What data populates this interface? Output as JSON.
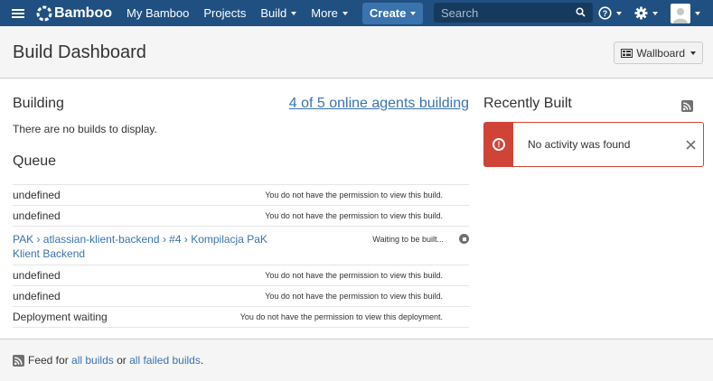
{
  "nav": {
    "brand": "Bamboo",
    "my_bamboo": "My Bamboo",
    "projects": "Projects",
    "build": "Build",
    "more": "More",
    "create": "Create",
    "search_placeholder": "Search"
  },
  "header": {
    "title": "Build Dashboard",
    "wallboard_label": "Wallboard"
  },
  "building": {
    "title": "Building",
    "agents_link": "4 of 5 online agents building",
    "empty_text": "There are no builds to display."
  },
  "queue": {
    "title": "Queue",
    "rows": [
      {
        "name": "undefined",
        "status": "You do not have the permission to view this build."
      },
      {
        "name": "undefined",
        "status": "You do not have the permission to view this build."
      },
      {
        "name": "PAK › atlassian-klient-backend › #4 › Kompilacja PaK Klient Backend",
        "status": "Waiting to be built..."
      },
      {
        "name": "undefined",
        "status": "You do not have the permission to view this build."
      },
      {
        "name": "undefined",
        "status": "You do not have the permission to view this build."
      },
      {
        "name": "Deployment waiting",
        "status": "You do not have the permission to view this deployment."
      }
    ]
  },
  "recent": {
    "title": "Recently Built",
    "alert_text": "No activity was found"
  },
  "footer": {
    "prefix": "Feed for",
    "all_builds": "all builds",
    "or": "or",
    "all_failed_builds": "all failed builds",
    "suffix": "."
  },
  "colors": {
    "nav_bg": "#205081",
    "link": "#3b73af",
    "error": "#d04437"
  }
}
